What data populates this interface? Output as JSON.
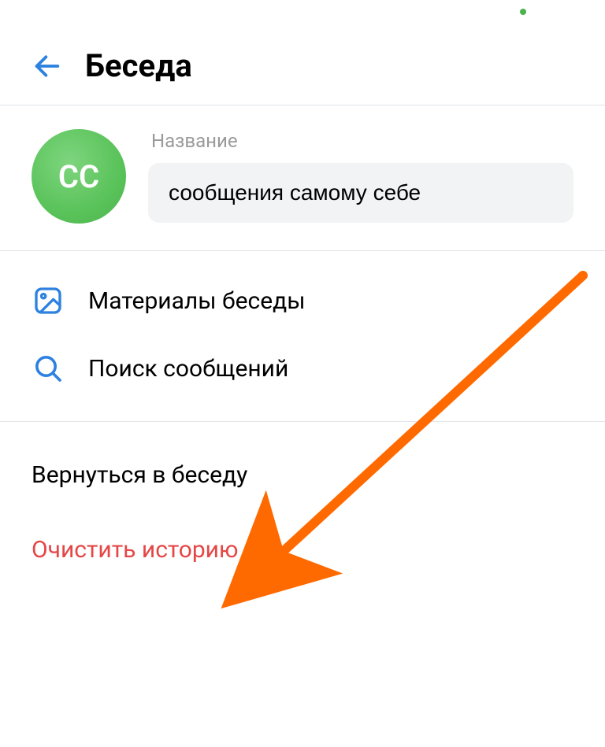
{
  "statusbar": {
    "indicator": "green"
  },
  "header": {
    "title": "Беседа"
  },
  "profile": {
    "avatar_initials": "СС",
    "name_label": "Название",
    "name_value": "сообщения самому себе"
  },
  "menu": {
    "materials_label": "Материалы беседы",
    "search_label": "Поиск сообщений"
  },
  "actions": {
    "return_label": "Вернуться в беседу",
    "clear_label": "Очистить историю"
  },
  "colors": {
    "accent_blue": "#2d81e0",
    "avatar_green": "#4bb34b",
    "danger_red": "#e64646",
    "arrow_orange": "#ff6a00"
  }
}
